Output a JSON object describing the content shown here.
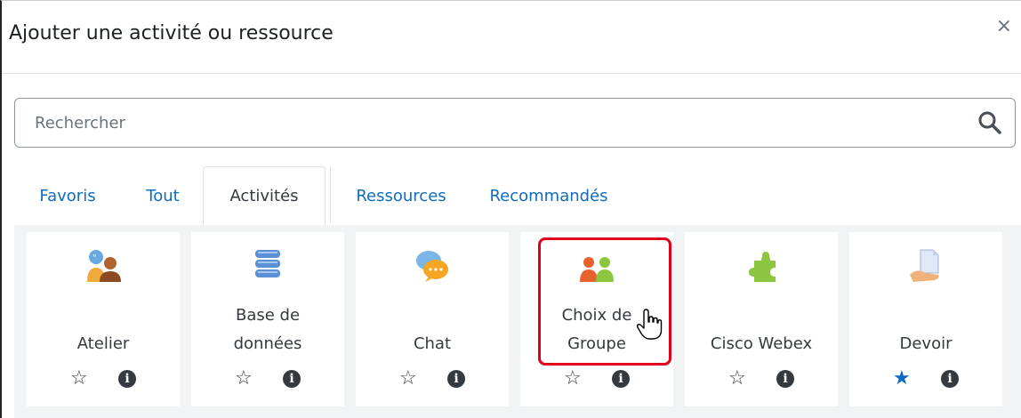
{
  "modal": {
    "title": "Ajouter une activité ou ressource",
    "close_label": "×"
  },
  "search": {
    "placeholder": "Rechercher",
    "icon": "search-icon"
  },
  "tabs": [
    {
      "label": "Favoris",
      "active": false
    },
    {
      "label": "Tout",
      "active": false
    },
    {
      "label": "Activités",
      "active": true
    },
    {
      "label": "Ressources",
      "active": false
    },
    {
      "label": "Recommandés",
      "active": false
    }
  ],
  "cards": [
    {
      "name_line1": "",
      "name_line2": "Atelier",
      "icon": "workshop-icon",
      "starred": false
    },
    {
      "name_line1": "Base de",
      "name_line2": "données",
      "icon": "database-icon",
      "starred": false
    },
    {
      "name_line1": "",
      "name_line2": "Chat",
      "icon": "chat-icon",
      "starred": false
    },
    {
      "name_line1": "Choix de",
      "name_line2": "Groupe",
      "icon": "group-choice-icon",
      "starred": false,
      "highlighted": true
    },
    {
      "name_line1": "",
      "name_line2": "Cisco Webex",
      "icon": "puzzle-icon",
      "starred": false
    },
    {
      "name_line1": "",
      "name_line2": "Devoir",
      "icon": "assignment-icon",
      "starred": true
    }
  ],
  "symbols": {
    "star_empty": "☆",
    "star_filled": "★",
    "info": "i"
  },
  "colors": {
    "link": "#0f6cbf",
    "highlight": "#e0001b",
    "text": "#343a40"
  }
}
